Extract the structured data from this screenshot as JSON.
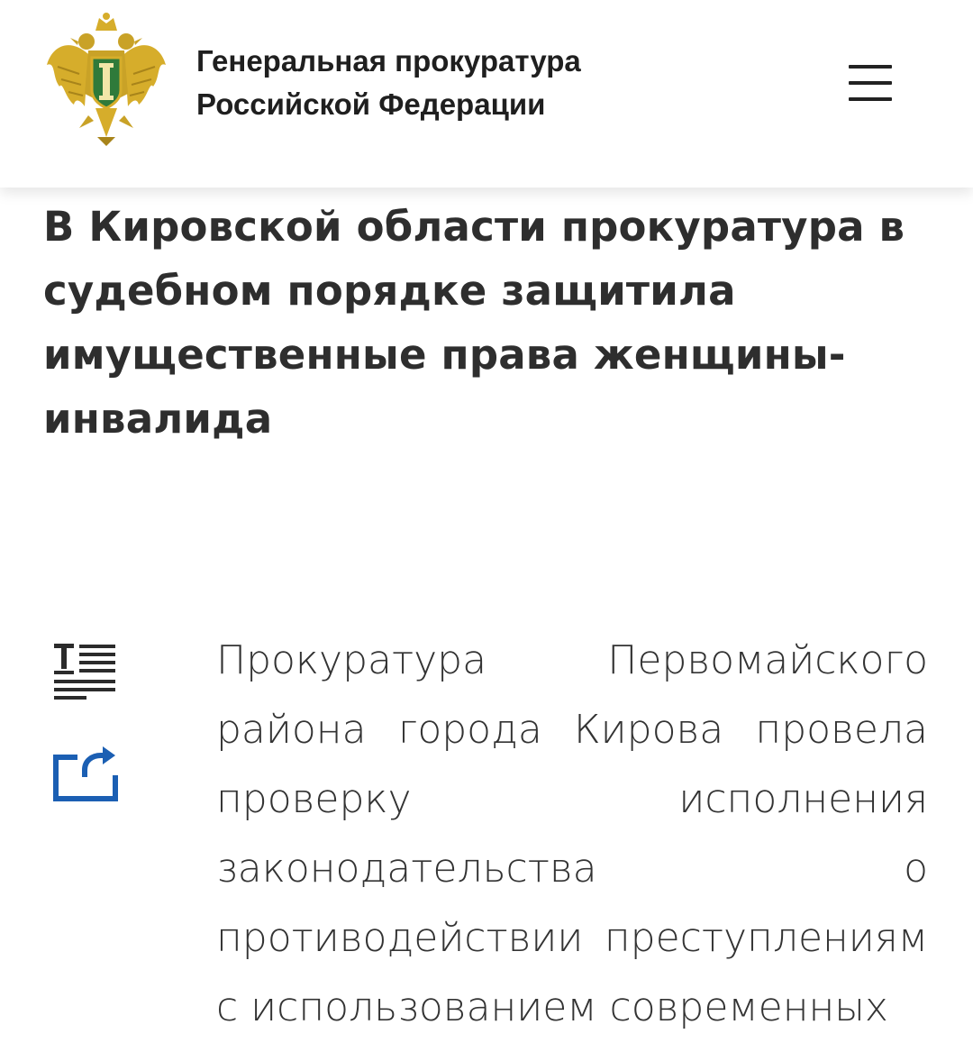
{
  "header": {
    "org_name_line1": "Генеральная прокуратура",
    "org_name_line2": "Российской Федерации",
    "emblem_icon": "prosecutor-emblem-icon",
    "menu_icon": "hamburger-menu-icon"
  },
  "article": {
    "title": "В Кировской области прокуратура в судебном порядке защитила имущественные права женщины-инвалида",
    "body": "Прокуратура Первомайского района города Кирова провела проверку исполнения законодательства о противодействии преступлениям с использованием современных"
  },
  "tools": {
    "text_size_icon": "text-size-icon",
    "share_icon": "share-icon"
  },
  "colors": {
    "accent_blue": "#1b5fb3",
    "text_dark": "#2e2e2e",
    "emblem_gold": "#d6ad2b",
    "emblem_green": "#2f7a3a"
  }
}
